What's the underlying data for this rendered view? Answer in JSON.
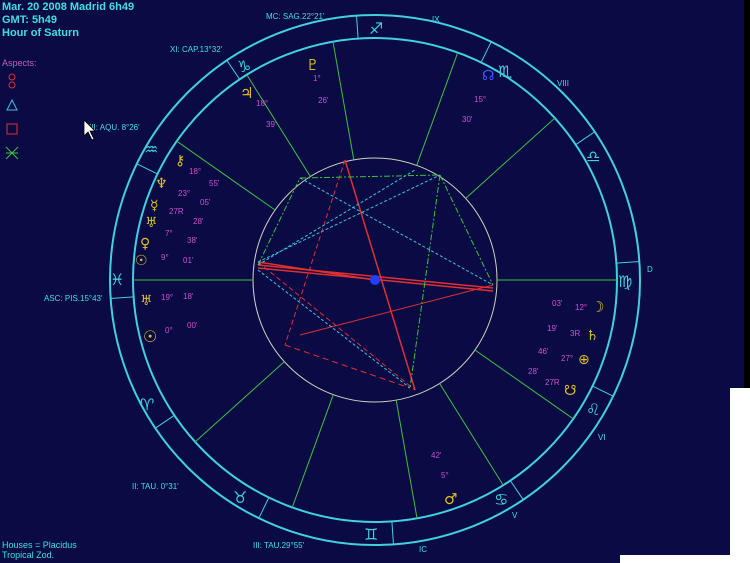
{
  "header": {
    "line1": "Mar. 20 2008 Madrid  6h49",
    "line2": "GMT: 5h49",
    "line3": "Hour of Saturn"
  },
  "aspects_panel": {
    "title": "Aspects:",
    "items": [
      {
        "name": "conjunction",
        "color": "#e03030"
      },
      {
        "name": "trine",
        "color": "#40c0e0"
      },
      {
        "name": "square",
        "color": "#e03030"
      },
      {
        "name": "sextile",
        "color": "#40c040"
      }
    ]
  },
  "footer": {
    "line1": "Houses = Placidus",
    "line2": "Tropical Zod."
  },
  "house_labels": {
    "asc": "ASC: PIS.15°43'",
    "xi": "XI: CAP.13°32'",
    "mc": "MC: SAG.22°21'",
    "xii": "XII: AQU. 8°26'",
    "ii": "II: TAU. 0°31'",
    "iii": "III: TAU.29°55'",
    "ix": "IX",
    "viii": "VIII",
    "vi": "VI",
    "v": "V",
    "ic": "IC",
    "d": "D"
  },
  "planet_degrees": {
    "pluto": [
      "1°",
      "26'"
    ],
    "saturn_top": [
      "18°",
      "39'"
    ],
    "node": [
      "15°",
      "30'"
    ],
    "left_group": [
      "18°",
      "23°",
      "27R",
      "7°",
      "9°"
    ],
    "left_group_min": [
      "55'",
      "05'",
      "28'",
      "38'",
      "01'"
    ],
    "asc_group": [
      "19°",
      "0°"
    ],
    "asc_group_min": [
      "18'",
      "00'"
    ],
    "right_group_deg": [
      "03'",
      "19'",
      "46'",
      "28'"
    ],
    "right_group_min": [
      "12°",
      "3R",
      "27°",
      "27R"
    ],
    "mars": [
      "42'",
      "5°"
    ]
  },
  "colors": {
    "background": "#000000",
    "chart_bg": "#0a0a44",
    "ring": "#40d0e0",
    "house_line": "#40c040",
    "planet": "#e0c020",
    "degree": "#d050d0",
    "label": "#40e0e0",
    "center_dot": "#2040ff"
  }
}
